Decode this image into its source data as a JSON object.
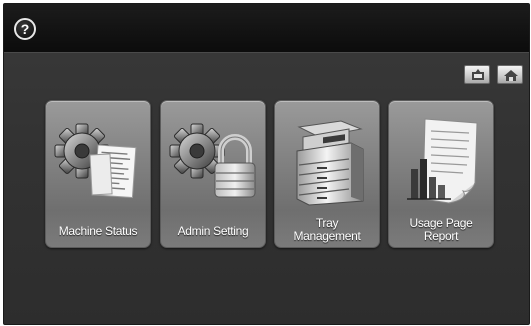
{
  "header": {
    "help_glyph": "?"
  },
  "tiles": [
    {
      "label": "Machine Status",
      "icon": "gear-document-icon"
    },
    {
      "label": "Admin Setting",
      "icon": "gear-lock-icon"
    },
    {
      "label_line1": "Tray",
      "label_line2": "Management",
      "icon": "printer-icon"
    },
    {
      "label_line1": "Usage Page",
      "label_line2": "Report",
      "icon": "bar-chart-report-icon"
    }
  ],
  "colors": {
    "background": "#333333",
    "topbar": "#121212",
    "tile": "#858585",
    "label": "#ffffff"
  }
}
